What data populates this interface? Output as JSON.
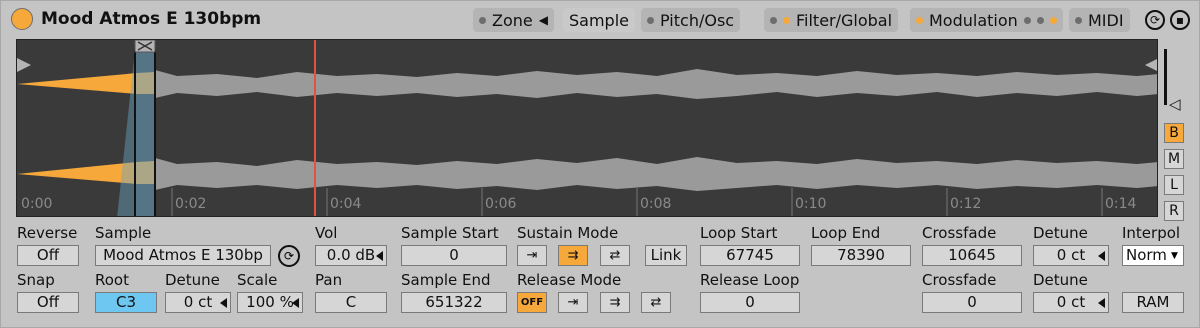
{
  "title": "Mood Atmos E 130bpm",
  "tabs": {
    "zone": "Zone",
    "sample": "Sample",
    "pitch": "Pitch/Osc",
    "filter": "Filter/Global",
    "modulation": "Modulation",
    "midi": "MIDI"
  },
  "waveform": {
    "time_ticks": [
      "0:00",
      "0:02",
      "0:04",
      "0:06",
      "0:08",
      "0:10",
      "0:12",
      "0:14"
    ]
  },
  "side_buttons": [
    "B",
    "M",
    "L",
    "R"
  ],
  "controls": {
    "reverse": {
      "label": "Reverse",
      "value": "Off"
    },
    "snap": {
      "label": "Snap",
      "value": "Off"
    },
    "sample": {
      "label": "Sample",
      "value": "Mood Atmos E 130bp"
    },
    "root": {
      "label": "Root",
      "value": "C3"
    },
    "detune": {
      "label": "Detune",
      "value": "0 ct"
    },
    "scale": {
      "label": "Scale",
      "value": "100 %"
    },
    "vol": {
      "label": "Vol",
      "value": "0.0 dB"
    },
    "pan": {
      "label": "Pan",
      "value": "C"
    },
    "sample_start": {
      "label": "Sample Start",
      "value": "0"
    },
    "sample_end": {
      "label": "Sample End",
      "value": "651322"
    },
    "sustain_mode": {
      "label": "Sustain Mode"
    },
    "release_mode": {
      "label": "Release Mode",
      "off": "OFF"
    },
    "link": "Link",
    "loop_start": {
      "label": "Loop Start",
      "value": "67745"
    },
    "loop_end": {
      "label": "Loop End",
      "value": "78390"
    },
    "release_loop": {
      "label": "Release Loop",
      "value": "0"
    },
    "crossfade1": {
      "label": "Crossfade",
      "value": "10645"
    },
    "crossfade2": {
      "label": "Crossfade",
      "value": "0"
    },
    "detune_loop": {
      "label": "Detune",
      "value": "0 ct"
    },
    "detune_release": {
      "label": "Detune",
      "value": "0 ct"
    },
    "interpol": {
      "label": "Interpol",
      "value": "Norm"
    },
    "ram": "RAM"
  }
}
